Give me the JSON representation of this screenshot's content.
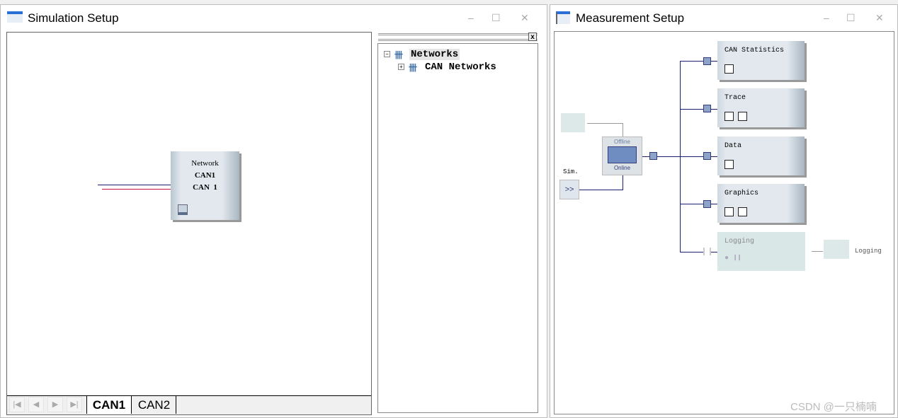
{
  "simulation": {
    "title": "Simulation Setup",
    "network_block": {
      "label": "Network",
      "name": "CAN1",
      "channel": "CAN  1"
    },
    "tree": {
      "root": "Networks",
      "child": "CAN Networks",
      "close": "x"
    },
    "tabs": [
      {
        "label": "CAN1",
        "active": true
      },
      {
        "label": "CAN2",
        "active": false
      }
    ]
  },
  "measurement": {
    "title": "Measurement Setup",
    "blocks": [
      {
        "label": "CAN Statistics"
      },
      {
        "label": "Trace"
      },
      {
        "label": "Data"
      },
      {
        "label": "Graphics"
      },
      {
        "label": "Logging",
        "disabled": true
      }
    ],
    "switch": {
      "offline": "Offline",
      "online": "Online"
    },
    "sim_label": "Sim.",
    "sim_button": ">>",
    "logging_output": "Logging"
  },
  "window_controls": {
    "minimize": "–",
    "maximize": "☐",
    "close": "✕"
  },
  "watermark": "CSDN @一只楠喃",
  "colors": {
    "line_blue": "#1b1f73",
    "line_red": "#c0143c",
    "port": "#8ea3c8"
  }
}
